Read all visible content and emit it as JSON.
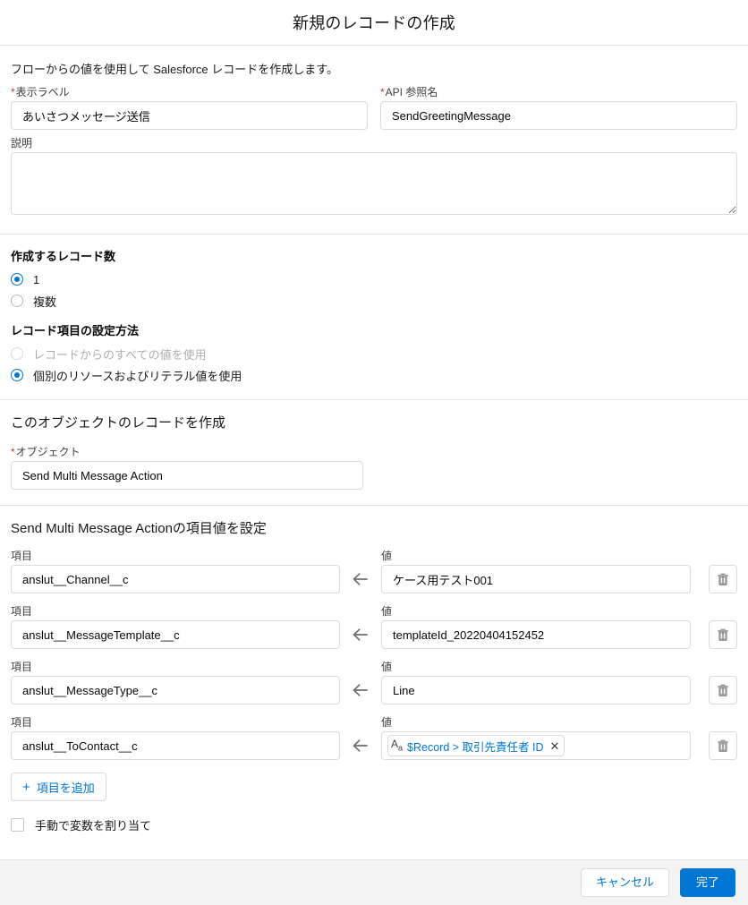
{
  "header": {
    "title": "新規のレコードの作成"
  },
  "intro": "フローからの値を使用して Salesforce レコードを作成します。",
  "labels": {
    "display_label": "表示ラベル",
    "api_name": "API 参照名",
    "description": "説明",
    "object": "オブジェクト",
    "field": "項目",
    "value": "値"
  },
  "inputs": {
    "display_label_value": "あいさつメッセージ送信",
    "display_label_placeholder": "",
    "api_name_value": "SendGreetingMessage",
    "api_name_placeholder": "",
    "description_value": "",
    "description_placeholder": "",
    "object_value": "Send Multi Message Action",
    "object_placeholder": ""
  },
  "record_count": {
    "title": "作成するレコード数",
    "options": [
      {
        "label": "1",
        "selected": true,
        "disabled": false
      },
      {
        "label": "複数",
        "selected": false,
        "disabled": false
      }
    ]
  },
  "field_method": {
    "title": "レコード項目の設定方法",
    "options": [
      {
        "label": "レコードからのすべての値を使用",
        "selected": false,
        "disabled": true
      },
      {
        "label": "個別のリソースおよびリテラル値を使用",
        "selected": true,
        "disabled": false
      }
    ]
  },
  "object_section": {
    "heading": "このオブジェクトのレコードを作成"
  },
  "fields_section": {
    "heading": "Send Multi Message Actionの項目値を設定",
    "rows": [
      {
        "field_label": "項目",
        "field_value": "anslut__Channel__c",
        "value_label": "値",
        "value_type": "text",
        "value_text": "ケース用テスト001",
        "arrow_icon": "arrow-left-icon",
        "delete_icon": "trash-icon"
      },
      {
        "field_label": "項目",
        "field_value": "anslut__MessageTemplate__c",
        "value_label": "値",
        "value_type": "text",
        "value_text": "templateId_20220404152452",
        "arrow_icon": "arrow-left-icon",
        "delete_icon": "trash-icon"
      },
      {
        "field_label": "項目",
        "field_value": "anslut__MessageType__c",
        "value_label": "値",
        "value_type": "text",
        "value_text": "Line",
        "arrow_icon": "arrow-left-icon",
        "delete_icon": "trash-icon"
      },
      {
        "field_label": "項目",
        "field_value": "anslut__ToContact__c",
        "value_label": "値",
        "value_type": "pill",
        "value_text": "$Record > 取引先責任者 ID",
        "pill_icon_top": "A",
        "pill_icon_bottom": "a",
        "pill_remove": "✕",
        "arrow_icon": "arrow-left-icon",
        "delete_icon": "trash-icon"
      }
    ],
    "add_field_button": "項目を追加",
    "add_field_plus": "+"
  },
  "manual_assign": {
    "label": "手動で変数を割り当て",
    "checked": false
  },
  "footer": {
    "cancel_label": "キャンセル",
    "done_label": "完了"
  },
  "colors": {
    "accent": "#0176d3",
    "required": "#c23934",
    "border": "#dddbda",
    "footer_bg": "#f3f3f3"
  }
}
